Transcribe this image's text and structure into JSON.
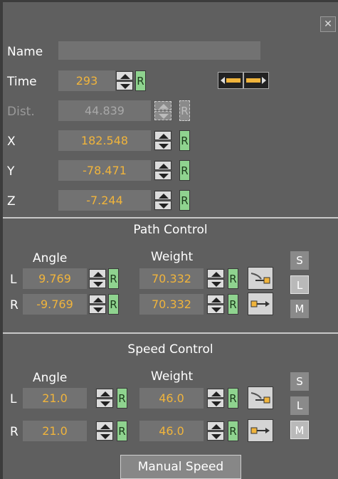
{
  "header": {
    "close_label": "✕"
  },
  "fields": {
    "name_label": "Name",
    "name_value": "",
    "time_label": "Time",
    "time_value": "293",
    "time_r": "R",
    "dist_label": "Dist.",
    "dist_value": "44.839",
    "dist_r": "R",
    "x_label": "X",
    "x_value": "182.548",
    "x_r": "R",
    "y_label": "Y",
    "y_value": "-78.471",
    "y_r": "R",
    "z_label": "Z",
    "z_value": "-7.244",
    "z_r": "R"
  },
  "path_control": {
    "title": "Path Control",
    "angle_header": "Angle",
    "weight_header": "Weight",
    "rows": [
      {
        "side": "L",
        "angle": "9.769",
        "weight": "70.332",
        "r": "R"
      },
      {
        "side": "R",
        "angle": "-9.769",
        "weight": "70.332",
        "r": "R"
      }
    ],
    "modes": [
      "S",
      "L",
      "M"
    ],
    "selected_mode": "L"
  },
  "speed_control": {
    "title": "Speed Control",
    "angle_header": "Angle",
    "weight_header": "Weight",
    "rows": [
      {
        "side": "L",
        "angle": "21.0",
        "weight": "46.0",
        "r": "R"
      },
      {
        "side": "R",
        "angle": "21.0",
        "weight": "46.0",
        "r": "R"
      }
    ],
    "modes": [
      "S",
      "L",
      "M"
    ],
    "selected_mode": "M",
    "manual_label": "Manual Speed"
  },
  "colors": {
    "accent": "#f0b43c",
    "panel": "#5f5f5f",
    "field": "#727272",
    "r_button": "#8fd38f"
  }
}
